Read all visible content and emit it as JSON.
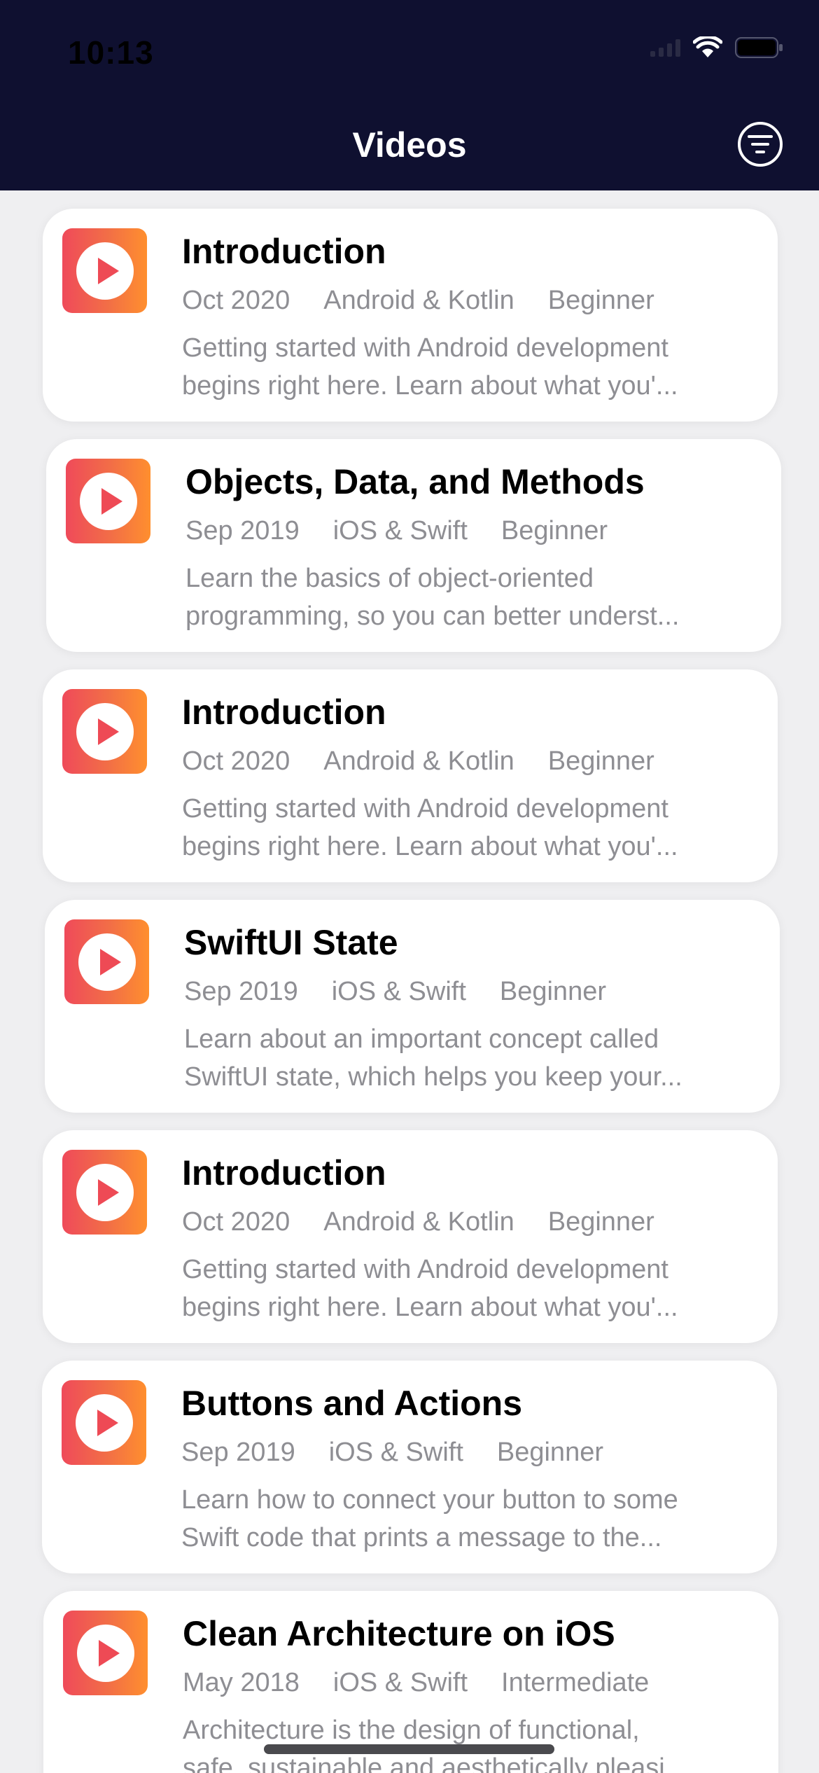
{
  "status_bar": {
    "time": "10:13"
  },
  "header": {
    "title": "Videos",
    "filter_icon": "filter-circle-icon",
    "background": "#0f1030"
  },
  "accent": {
    "gradient_start": "#ef4a5a",
    "gradient_end": "#ff8f2e"
  },
  "videos": [
    {
      "title": "Introduction",
      "date": "Oct 2020",
      "platform": "Android & Kotlin",
      "level": "Beginner",
      "desc_line1": "Getting started with Android development",
      "desc_line2": "begins right here. Learn about what you'..."
    },
    {
      "title": "Objects, Data, and Methods",
      "date": "Sep 2019",
      "platform": "iOS & Swift",
      "level": "Beginner",
      "desc_line1": "Learn the basics of object-oriented",
      "desc_line2": "programming, so you can better underst..."
    },
    {
      "title": "Introduction",
      "date": "Oct 2020",
      "platform": "Android & Kotlin",
      "level": "Beginner",
      "desc_line1": "Getting started with Android development",
      "desc_line2": "begins right here. Learn about what you'..."
    },
    {
      "title": "SwiftUI State",
      "date": "Sep 2019",
      "platform": "iOS & Swift",
      "level": "Beginner",
      "desc_line1": "Learn about an important concept called",
      "desc_line2": "SwiftUI state, which helps you keep your..."
    },
    {
      "title": "Introduction",
      "date": "Oct 2020",
      "platform": "Android & Kotlin",
      "level": "Beginner",
      "desc_line1": "Getting started with Android development",
      "desc_line2": "begins right here. Learn about what you'..."
    },
    {
      "title": "Buttons and Actions",
      "date": "Sep 2019",
      "platform": "iOS & Swift",
      "level": "Beginner",
      "desc_line1": "Learn how to connect your button to some",
      "desc_line2": "Swift code that prints a message to the..."
    },
    {
      "title": "Clean Architecture on iOS",
      "date": "May 2018",
      "platform": "iOS & Swift",
      "level": "Intermediate",
      "desc_line1": "Architecture is the design of functional,",
      "desc_line2": "safe, sustainable and aesthetically pleasi..."
    }
  ]
}
